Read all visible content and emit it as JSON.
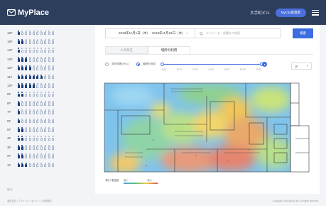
{
  "header": {
    "app_name": "MyPlace",
    "building": "大手町ビル",
    "user_label": "MyCity管理者"
  },
  "sidebar": {
    "floors": [
      {
        "label": "16F",
        "occupied": 1,
        "total": 10
      },
      {
        "label": "15F",
        "occupied": 2,
        "total": 10
      },
      {
        "label": "14F",
        "occupied": 1,
        "total": 10
      },
      {
        "label": "13F",
        "occupied": 3,
        "total": 10
      },
      {
        "label": "12F",
        "occupied": 4,
        "total": 10
      },
      {
        "label": "11F",
        "occupied": 7,
        "total": 10
      },
      {
        "label": "10F",
        "occupied": 5,
        "total": 10
      },
      {
        "label": "9F",
        "occupied": 2,
        "total": 10
      },
      {
        "label": "8F",
        "occupied": 1,
        "total": 10
      },
      {
        "label": "7F",
        "occupied": 1,
        "total": 10
      },
      {
        "label": "6F",
        "occupied": 1,
        "total": 10
      },
      {
        "label": "5F",
        "occupied": 2,
        "total": 10
      },
      {
        "label": "4F",
        "occupied": 2,
        "total": 10
      },
      {
        "label": "3F",
        "occupied": 2,
        "total": 10
      },
      {
        "label": "2F",
        "occupied": 2,
        "total": 10
      },
      {
        "label": "1F",
        "occupied": 3,
        "total": 10
      }
    ],
    "back_label": "戻る"
  },
  "search": {
    "date_range": "2018年11月1日（木）- 2018年11月31日（木）",
    "placeholder": "メンバー名・部署名で検索",
    "button_label": "検索"
  },
  "tabs": [
    {
      "label": "人の所在",
      "active": false
    },
    {
      "label": "場所の利用",
      "active": true
    }
  ],
  "mode": {
    "option_a": "滞在時間(分/人)",
    "option_b": "時間を指定",
    "selected": "option_b"
  },
  "timeline": {
    "ticks": [
      "8:00",
      "10:00",
      "12:00",
      "14:00",
      "16:00",
      "18:00",
      "20:00"
    ],
    "position": 1.0
  },
  "floor_select": {
    "value": "1F",
    "chevron": "chevron-down-icon"
  },
  "legend": {
    "title": "滞在人数密度",
    "low": "低い",
    "high": "高い"
  },
  "footer": {
    "left": "運営会社 | プライバシーポリシー | 利用規約",
    "right": "Copyright 2018 MyCity Inc. All rights reserved."
  }
}
